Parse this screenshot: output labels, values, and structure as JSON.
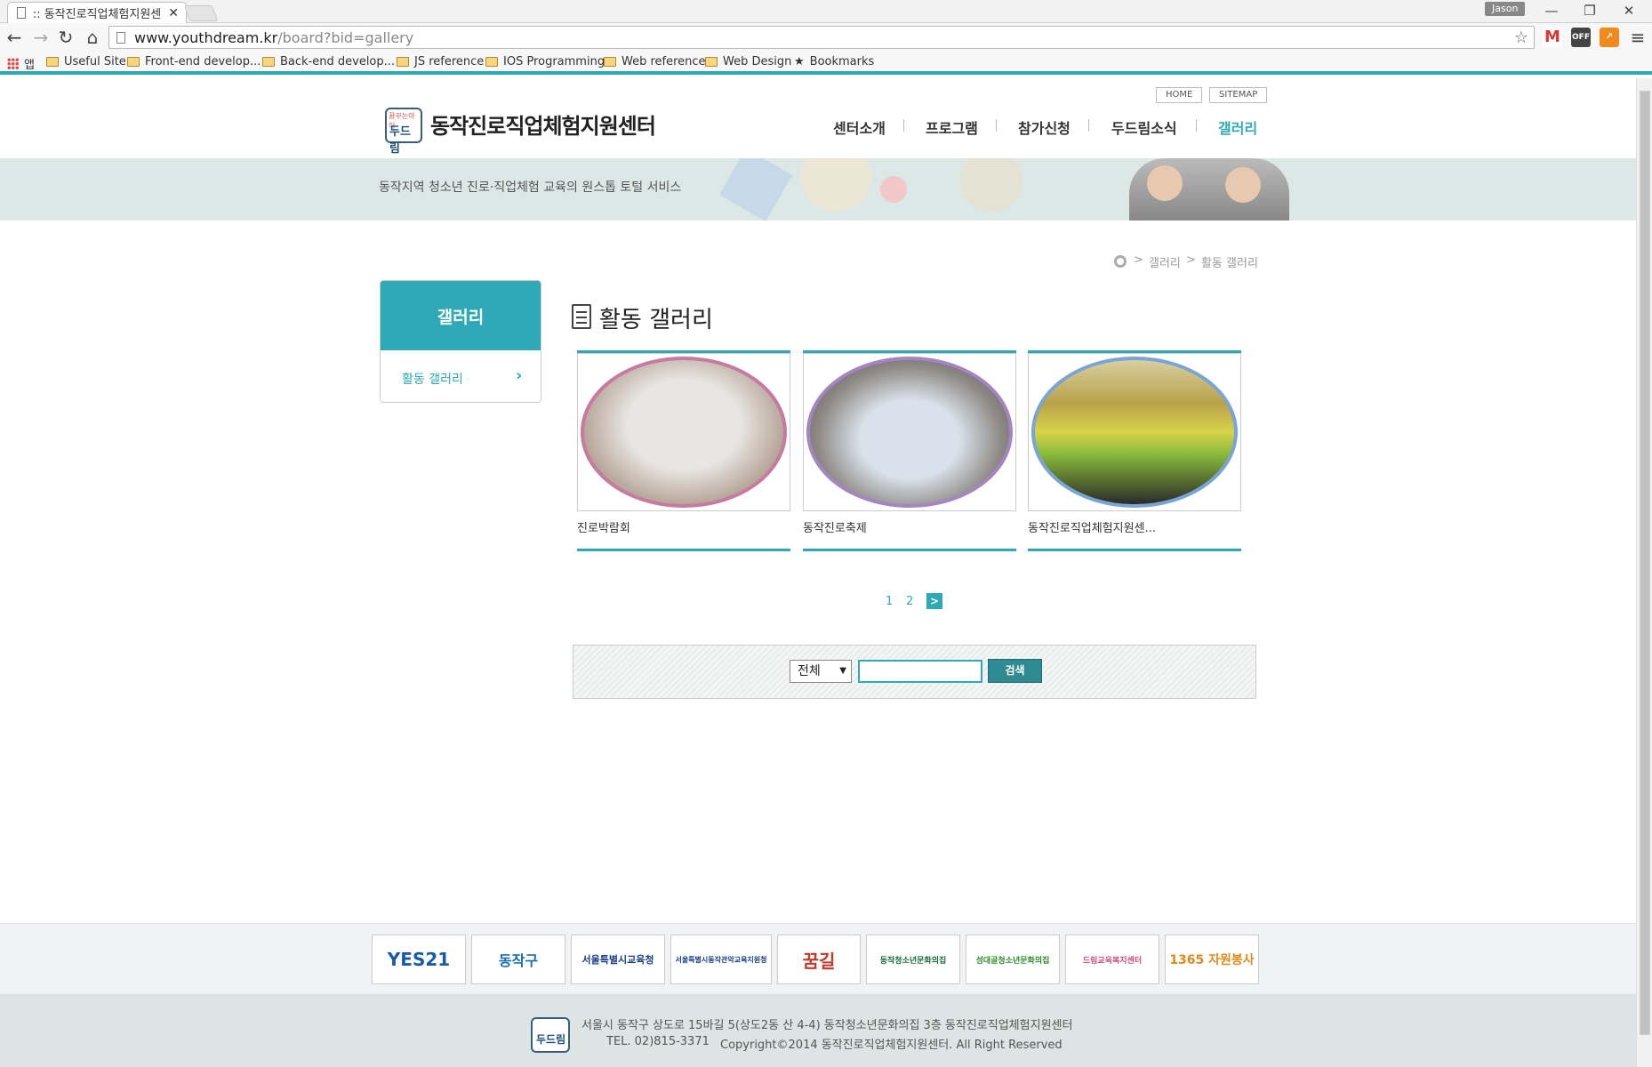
{
  "browser": {
    "tab_title": ":: 동작진로직업체험지원센",
    "user": "Jason",
    "url_host": "www.youthdream.kr",
    "url_path": "/board?bid=gallery",
    "bookmarks": [
      "앱",
      "Useful Site",
      "Front-end develop...",
      "Back-end develop...",
      "JS reference",
      "IOS Programming",
      "Web reference",
      "Web Design",
      "Bookmarks"
    ],
    "ext_off_label": "OFF"
  },
  "header": {
    "util_links": [
      "HOME",
      "SITEMAP"
    ],
    "logo_small": "꿈꾸는아이",
    "logo_main": "두드림",
    "site_title": "동작진로직업체험지원센터",
    "nav": [
      "센터소개",
      "프로그램",
      "참가신청",
      "두드림소식",
      "갤러리"
    ],
    "active_nav": "갤러리",
    "banner_text": "동작지역 청소년 진로·직업체험 교육의 원스톱 토털 서비스"
  },
  "breadcrumb": [
    ">",
    "갤러리",
    ">",
    "활동 갤러리"
  ],
  "sidebar": {
    "title": "갤러리",
    "items": [
      {
        "label": "활동 갤러리"
      }
    ]
  },
  "main": {
    "title": "활동 갤러리",
    "gallery": [
      {
        "title": "진로박람회"
      },
      {
        "title": "동작진로축제"
      },
      {
        "title": "동작진로직업체험지원센..."
      }
    ],
    "pagination": {
      "pages": [
        "1",
        "2"
      ],
      "next_label": ">"
    },
    "search": {
      "select_value": "전체",
      "input_value": "",
      "button_label": "검색"
    }
  },
  "partners": [
    "YES21",
    "동작구",
    "서울특별시교육청",
    "서울특별시동작관악교육지원청",
    "꿈길",
    "동작청소년문화의집",
    "성대골청소년문화의집",
    "드림교육복지센터",
    "1365 자원봉사"
  ],
  "footer": {
    "address": "서울시 동작구 상도로 15바길 5(상도2동 산 4-4) 동작청소년문화의집 3층 동작진로직업체험지원센터",
    "tel": "TEL. 02)815-3371",
    "copyright": "Copyright©2014 동작진로직업체험지원센터. All Right Reserved"
  },
  "colors": {
    "accent": "#2fa9b5",
    "banner": "#dce8e6",
    "footer": "#dce4e4"
  }
}
